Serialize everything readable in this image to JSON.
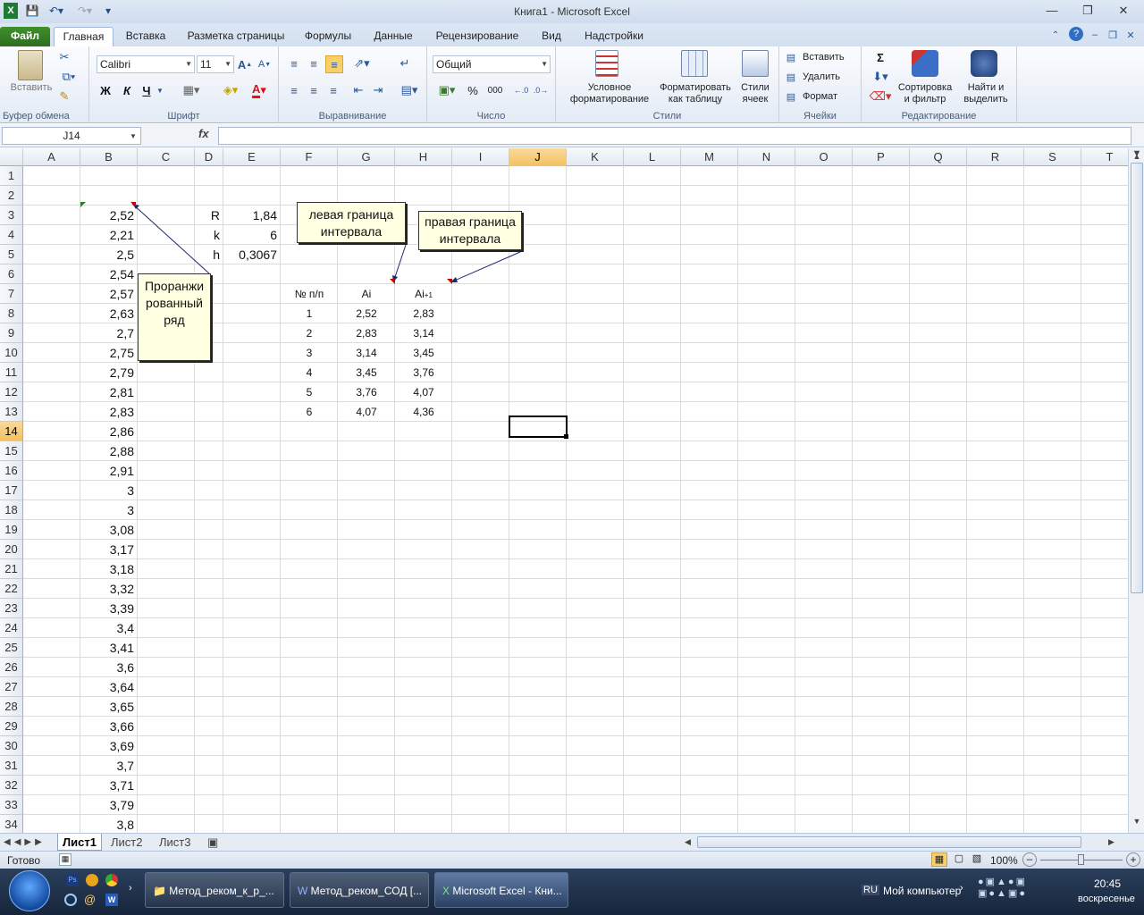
{
  "window": {
    "title": "Книга1  -  Microsoft Excel"
  },
  "ribbon": {
    "tabs": [
      "Файл",
      "Главная",
      "Вставка",
      "Разметка страницы",
      "Формулы",
      "Данные",
      "Рецензирование",
      "Вид",
      "Надстройки"
    ],
    "groups": {
      "clipboard": "Буфер обмена",
      "font": "Шрифт",
      "alignment": "Выравнивание",
      "number": "Число",
      "styles": "Стили",
      "cells": "Ячейки",
      "editing": "Редактирование"
    },
    "paste": "Вставить",
    "font_name": "Calibri",
    "font_size": "11",
    "bold": "Ж",
    "italic": "К",
    "underline": "Ч",
    "number_format": "Общий",
    "conditional": "Условное\nформатирование",
    "format_table": "Форматировать\nкак таблицу",
    "cell_styles": "Стили\nячеек",
    "insert": "Вставить",
    "delete": "Удалить",
    "format": "Формат",
    "sort": "Сортировка\nи фильтр",
    "find": "Найти и\nвыделить",
    "percent": "%",
    "thousands": "000",
    "sum": "Σ"
  },
  "formula_bar": {
    "name_box": "J14",
    "fx": "fx",
    "value": ""
  },
  "columns": [
    "A",
    "B",
    "C",
    "D",
    "E",
    "F",
    "G",
    "H",
    "I",
    "J",
    "K",
    "L",
    "M",
    "N",
    "O",
    "P",
    "Q",
    "R",
    "S",
    "T"
  ],
  "rows": [
    "1",
    "2",
    "3",
    "4",
    "5",
    "6",
    "7",
    "8",
    "9",
    "10",
    "11",
    "12",
    "13",
    "14",
    "15",
    "16",
    "17",
    "18",
    "19",
    "20",
    "21",
    "22",
    "23",
    "24",
    "25",
    "26",
    "27",
    "28",
    "29",
    "30",
    "31",
    "32",
    "33",
    "34"
  ],
  "cells": {
    "B": [
      "2,52",
      "2,21",
      "2,5",
      "2,54",
      "2,57",
      "2,63",
      "2,7",
      "2,75",
      "2,79",
      "2,81",
      "2,83",
      "2,86",
      "2,88",
      "2,91",
      "3",
      "3",
      "3,08",
      "3,17",
      "3,18",
      "3,32",
      "3,39",
      "3,4",
      "3,41",
      "3,6",
      "3,64",
      "3,65",
      "3,66",
      "3,69",
      "3,7",
      "3,71",
      "3,79",
      "3,8"
    ],
    "D": [
      "R",
      "k",
      "h"
    ],
    "E": [
      "1,84",
      "6",
      "0,3067"
    ],
    "F7": "№ п/п",
    "G7": "Ai",
    "H7_base": "Ai",
    "H7_sub": "+1",
    "table": [
      [
        "1",
        "2,52",
        "2,83"
      ],
      [
        "2",
        "2,83",
        "3,14"
      ],
      [
        "3",
        "3,14",
        "3,45"
      ],
      [
        "4",
        "3,45",
        "3,76"
      ],
      [
        "5",
        "3,76",
        "4,07"
      ],
      [
        "6",
        "4,07",
        "4,36"
      ]
    ]
  },
  "callouts": {
    "ranked": "Проранжи\nрованный\nряд",
    "left": "левая граница\nинтервала",
    "right": "правая граница\nинтервала"
  },
  "sheets": [
    "Лист1",
    "Лист2",
    "Лист3"
  ],
  "status": {
    "ready": "Готово",
    "zoom": "100%"
  },
  "taskbar": {
    "items": [
      "Метод_реком_к_р_...",
      "Метод_реком_СОД [...",
      "Microsoft Excel - Кни..."
    ],
    "lang": "RU",
    "computer": "Мой компьютер",
    "time": "20:45",
    "day": "воскресенье"
  }
}
